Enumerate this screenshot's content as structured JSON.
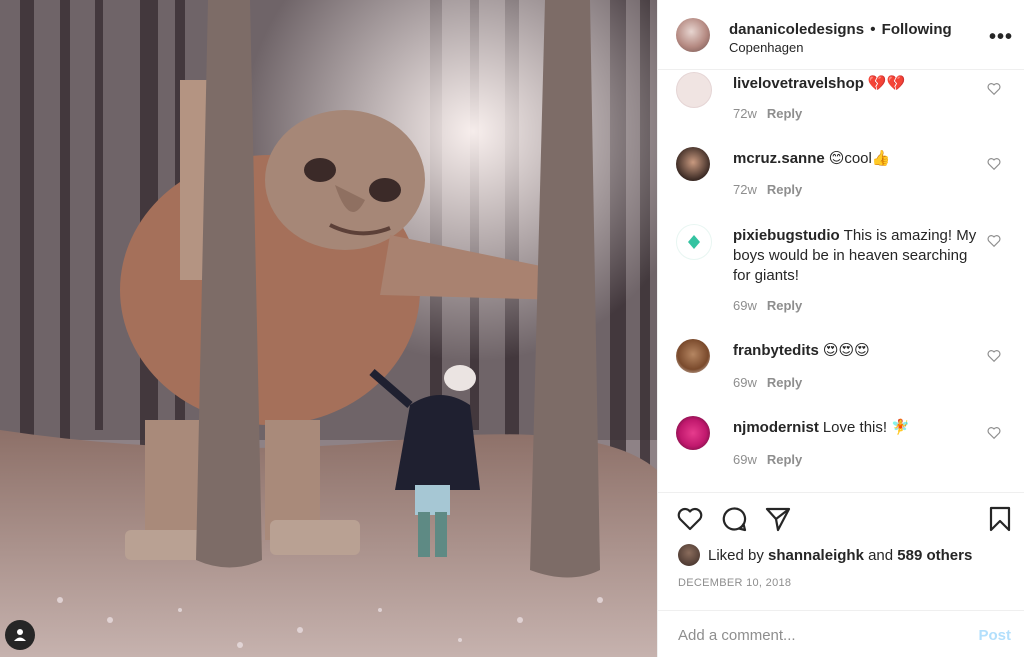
{
  "post": {
    "username": "dananicoledesigns",
    "separator": "•",
    "follow_status": "Following",
    "location": "Copenhagen",
    "more_label": "•••"
  },
  "comments": [
    {
      "user": "livelovetravelshop",
      "text": "💔💔",
      "age": "72w",
      "reply": "Reply",
      "avatar_color": "#f0e4e2"
    },
    {
      "user": "mcruz.sanne",
      "text": "😊cool👍",
      "age": "72w",
      "reply": "Reply",
      "avatar_color": "#3b2a24"
    },
    {
      "user": "pixiebugstudio",
      "text": "This is amazing! My boys would be in heaven searching for giants!",
      "age": "69w",
      "reply": "Reply",
      "avatar_color": "#34c3a1"
    },
    {
      "user": "franbytedits",
      "text": "😍😍😍",
      "age": "69w",
      "reply": "Reply",
      "avatar_color": "#7a4a2c"
    },
    {
      "user": "njmodernist",
      "text": "Love this! 🧚",
      "age": "69w",
      "reply": "Reply",
      "avatar_color": "#c0186d"
    }
  ],
  "likes": {
    "prefix": "Liked by",
    "user": "shannaleighk",
    "conjunction": "and",
    "count": "589 others"
  },
  "date": "DECEMBER 10, 2018",
  "add_comment": {
    "placeholder": "Add a comment...",
    "post_label": "Post"
  },
  "icons": {
    "like": "heart-icon",
    "comment": "comment-icon",
    "share": "share-icon",
    "save": "bookmark-icon",
    "user_tag": "user-icon"
  },
  "colors": {
    "text": "#262626",
    "muted": "#8e8e8e",
    "post_disabled": "#b2dffc"
  }
}
